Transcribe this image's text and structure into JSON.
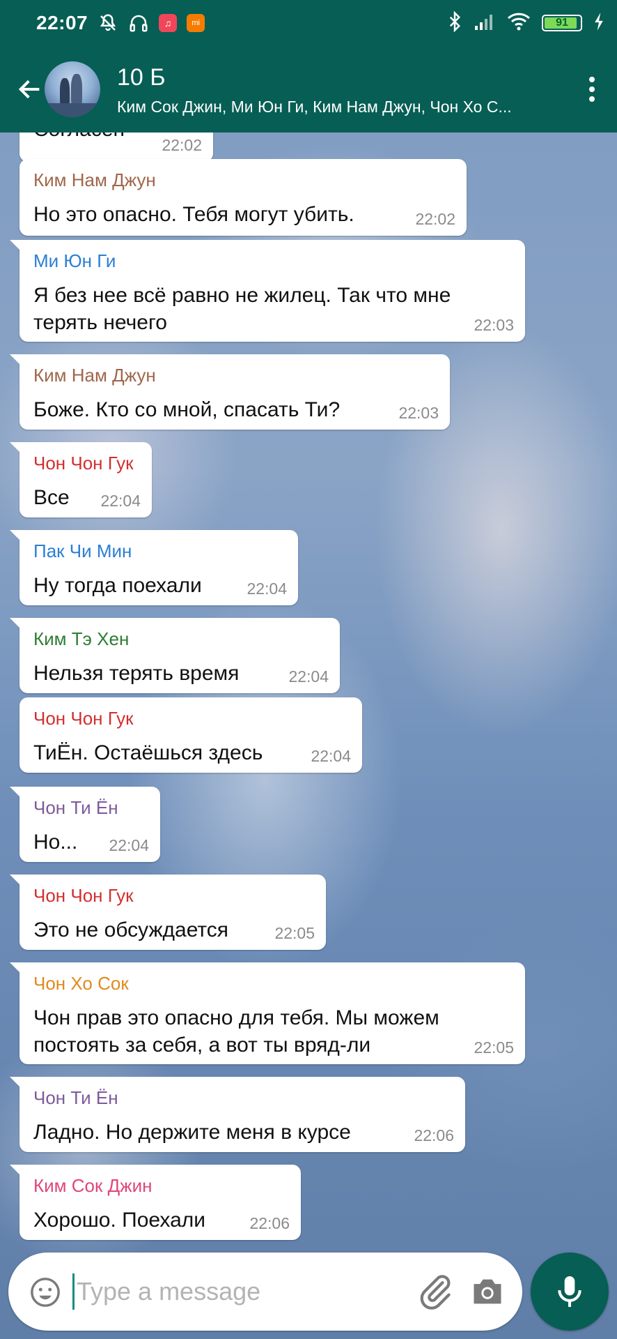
{
  "status_bar": {
    "time": "22:07",
    "battery_level": 91,
    "battery_text": "91",
    "icons": [
      "mute-icon",
      "headphones-icon",
      "music-app-icon",
      "mi-app-icon",
      "bluetooth-icon",
      "signal-icon",
      "wifi-icon",
      "battery-icon",
      "charging-icon"
    ]
  },
  "header": {
    "title": "10 Б",
    "members": "Ким Сок Джин, Ми Юн Ги, Ким Нам Джун, Чон Хо С..."
  },
  "colors": {
    "header": "#075e54",
    "accent": "#128c7e"
  },
  "messages": [
    {
      "sender": "",
      "text": "Согласен",
      "time": "22:02",
      "color": "#000000"
    },
    {
      "sender": "Ким Нам Джун",
      "text": "Но это опасно. Тебя могут убить.",
      "time": "22:02",
      "color": "#a0664a"
    },
    {
      "sender": "Ми Юн Ги",
      "text": "Я без нее всё равно не жилец. Так что мне терять нечего",
      "time": "22:03",
      "color": "#2a7fd4"
    },
    {
      "sender": "Ким Нам Джун",
      "text": "Боже. Кто со мной, спасать Ти?",
      "time": "22:03",
      "color": "#a0664a"
    },
    {
      "sender": "Чон Чон Гук",
      "text": "Все",
      "time": "22:04",
      "color": "#d32f2f"
    },
    {
      "sender": "Пак Чи Мин",
      "text": "Ну тогда поехали",
      "time": "22:04",
      "color": "#2a7fd4"
    },
    {
      "sender": "Ким Тэ Хен",
      "text": "Нельзя терять время",
      "time": "22:04",
      "color": "#2e7d32"
    },
    {
      "sender": "Чон Чон Гук",
      "text": "ТиЁн. Остаёшься здесь",
      "time": "22:04",
      "color": "#d32f2f"
    },
    {
      "sender": "Чон Ти Ён",
      "text": "Но...",
      "time": "22:04",
      "color": "#7e5a9b"
    },
    {
      "sender": "Чон Чон Гук",
      "text": "Это не обсуждается",
      "time": "22:05",
      "color": "#d32f2f"
    },
    {
      "sender": "Чон Хо Сок",
      "text": "Чон прав это опасно для тебя. Мы можем постоять за себя, а вот ты вряд-ли",
      "time": "22:05",
      "color": "#e08a1e"
    },
    {
      "sender": "Чон Ти Ён",
      "text": "Ладно. Но держите меня в курсе",
      "time": "22:06",
      "color": "#7e5a9b"
    },
    {
      "sender": "Ким Сок Джин",
      "text": "Хорошо. Поехали",
      "time": "22:06",
      "color": "#e0457b"
    }
  ],
  "input": {
    "placeholder": "Type a message",
    "value": ""
  }
}
